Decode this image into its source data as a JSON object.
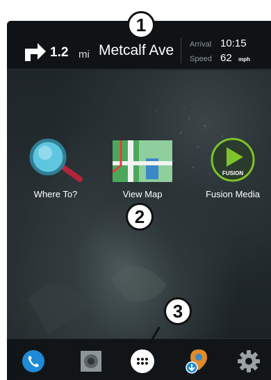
{
  "nav_bar": {
    "distance_value": "1.2",
    "distance_unit": "mi",
    "street": "Metcalf Ave",
    "arrival_label": "Arrival",
    "arrival_time": "10:15",
    "speed_label": "Speed",
    "speed_value": "62",
    "speed_unit": "mph"
  },
  "apps": [
    {
      "label": "Where To?",
      "icon": "magnifier-icon"
    },
    {
      "label": "View Map",
      "icon": "map-icon"
    },
    {
      "label": "Fusion Media",
      "icon": "fusion-play-icon",
      "logo_text": "FUSION"
    }
  ],
  "dock": [
    {
      "icon": "phone-icon"
    },
    {
      "icon": "speaker-icon"
    },
    {
      "icon": "app-drawer-icon"
    },
    {
      "icon": "location-download-icon"
    },
    {
      "icon": "settings-gear-icon"
    }
  ],
  "callouts": [
    "1",
    "2",
    "3"
  ],
  "colors": {
    "accent_blue": "#1f8ad6",
    "fusion_green": "#7fc32a"
  }
}
